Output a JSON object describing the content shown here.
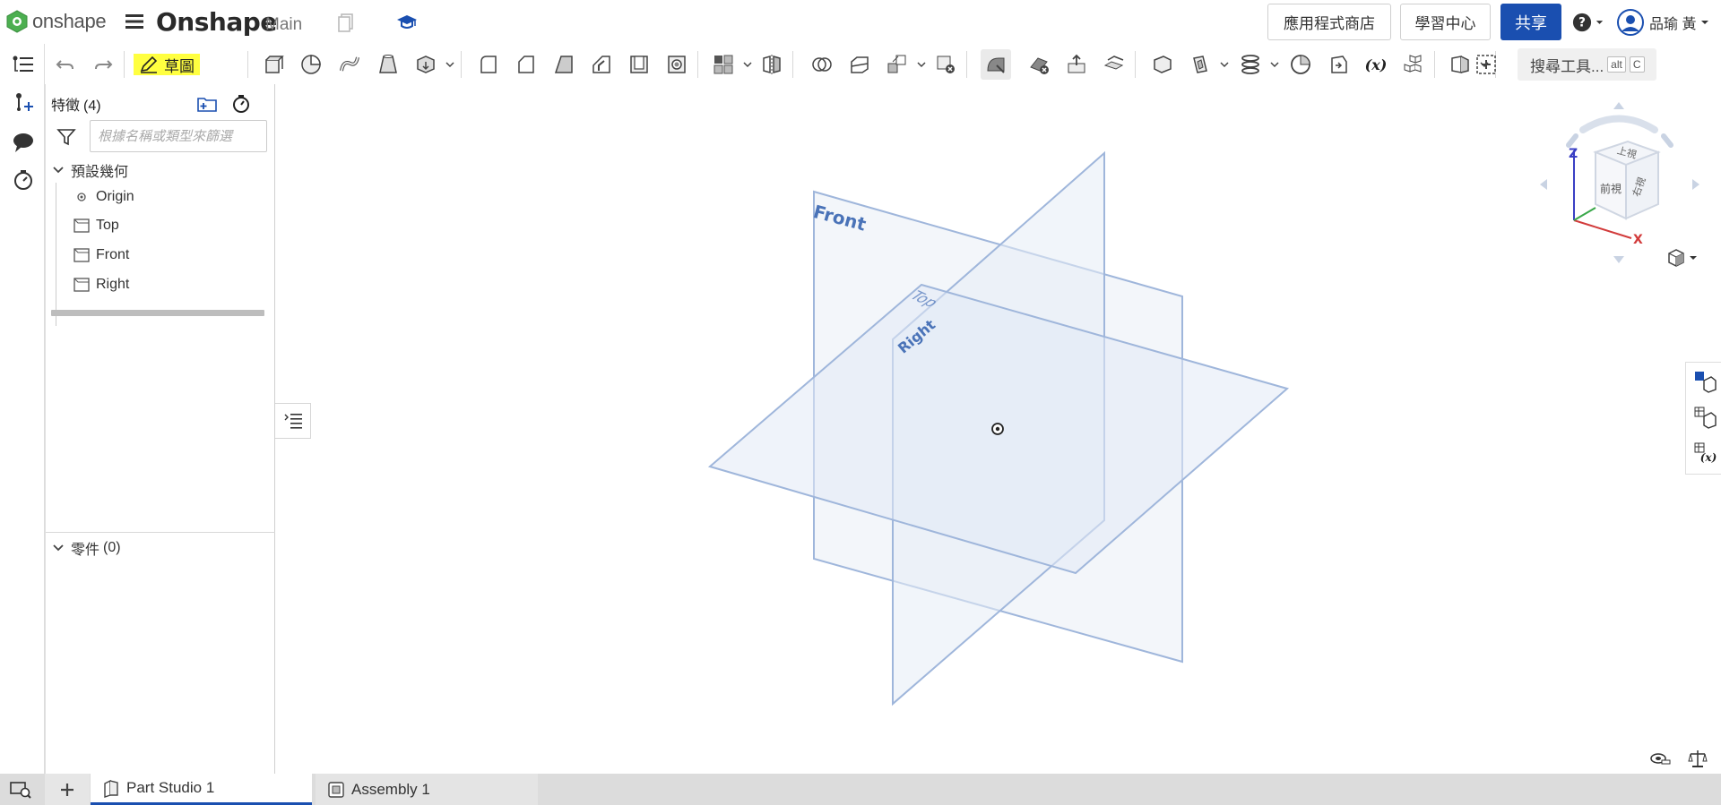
{
  "header": {
    "logo_text": "onshape",
    "doc_title": "Onshape",
    "branch": "Main",
    "app_store": "應用程式商店",
    "learning_center": "學習中心",
    "share": "共享",
    "help": "?",
    "user_name": "品瑜 黃"
  },
  "toolbar": {
    "sketch_label": "草圖",
    "search_tools": "搜尋工具...",
    "shortcut_keys": [
      "alt",
      "C"
    ]
  },
  "feature_panel": {
    "title": "特徵",
    "count": "(4)",
    "filter_placeholder": "根據名稱或類型來篩選",
    "default_geometry_label": "預設幾何",
    "features": [
      {
        "name": "Origin",
        "icon": "origin-icon"
      },
      {
        "name": "Top",
        "icon": "plane-icon"
      },
      {
        "name": "Front",
        "icon": "plane-icon"
      },
      {
        "name": "Right",
        "icon": "plane-icon"
      }
    ],
    "parts_label": "零件",
    "parts_count": "(0)"
  },
  "viewport": {
    "plane_labels": {
      "front": "Front",
      "top": "Top",
      "right": "Right"
    },
    "viewcube": {
      "top": "上視",
      "front": "前視",
      "right": "右視",
      "axis_z": "Z",
      "axis_x": "X"
    }
  },
  "tabs": [
    {
      "label": "Part Studio 1",
      "icon": "part-studio-icon",
      "active": true
    },
    {
      "label": "Assembly 1",
      "icon": "assembly-icon",
      "active": false
    }
  ],
  "colors": {
    "accent": "#1a4fb0",
    "sketch_highlight": "#ffff40",
    "plane_fill": "#e8eef7",
    "plane_stroke": "#9bb3d9"
  }
}
